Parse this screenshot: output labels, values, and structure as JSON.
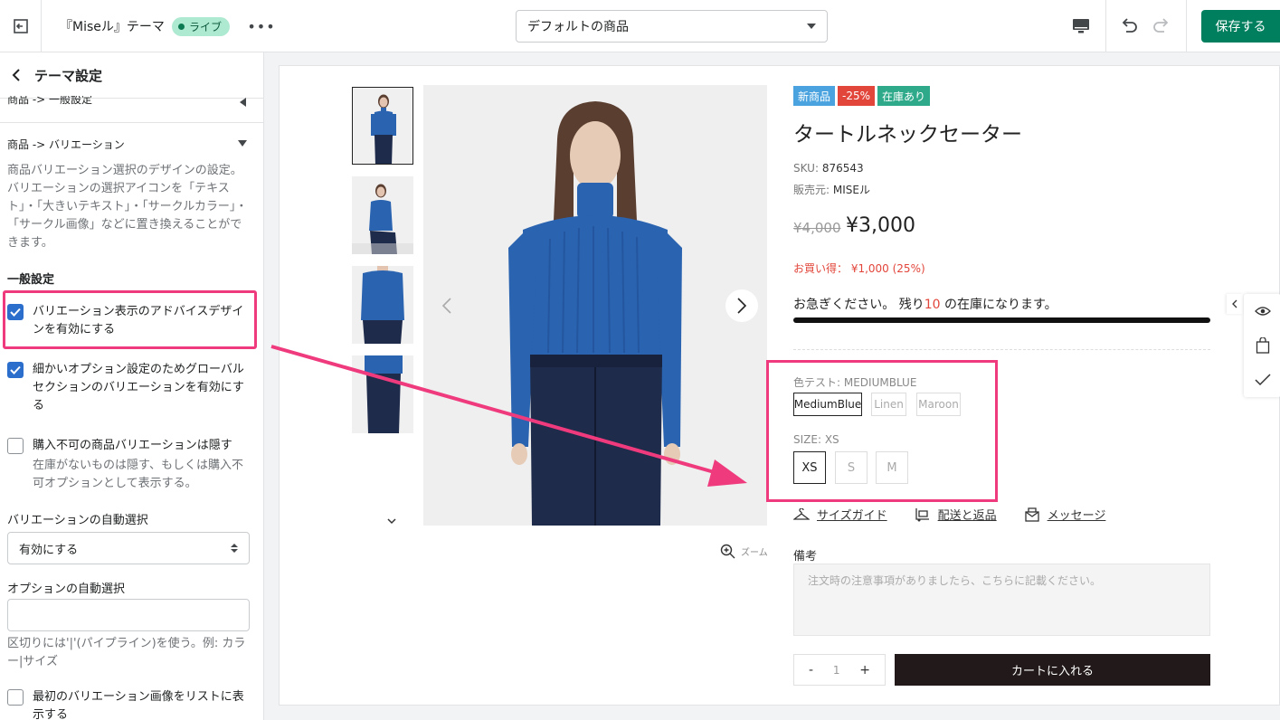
{
  "topbar": {
    "theme_name": "『Miseル』テーマ",
    "live_badge": "ライブ",
    "page_select": "デフォルトの商品",
    "save_label": "保存する"
  },
  "sidebar": {
    "title": "テーマ設定",
    "section_general": "商品 -> 一般設定",
    "section_variation": "商品 -> バリエーション",
    "description": "商品バリエーション選択のデザインの設定。バリエーションの選択アイコンを「テキスト」・「大きいテキスト」・「サークルカラー」・「サークル画像」などに置き換えることができます。",
    "general_heading": "一般設定",
    "checkbox1": "バリエーション表示のアドバイスデザインを有効にする",
    "checkbox2": "細かいオプション設定のためグローバルセクションのバリエーションを有効にする",
    "checkbox3": "購入不可の商品バリエーションは隠す",
    "checkbox3_help": "在庫がないものは隠す、もしくは購入不可オプションとして表示する。",
    "auto_select_label": "バリエーションの自動選択",
    "auto_select_value": "有効にする",
    "option_auto_label": "オプションの自動選択",
    "option_auto_value": "",
    "option_auto_help": "区切りには'|'(パイプライン)を使う。例: カラー|サイズ",
    "checkbox4": "最初のバリエーション画像をリストに表示する"
  },
  "product": {
    "badges": [
      "新商品",
      "-25%",
      "在庫あり"
    ],
    "badge_colors": [
      "#4aa3df",
      "#e2453a",
      "#2eaa8a"
    ],
    "title": "タートルネックセーター",
    "sku_label": "SKU:",
    "sku": "876543",
    "vendor_label": "販売元:",
    "vendor": "MISEル",
    "old_price": "¥4,000",
    "price": "¥3,000",
    "saving": "お買い得： ¥1,000 (25%)",
    "stock_pre": "お急ぎください。 残り",
    "stock_count": "10",
    "stock_post": "の在庫になります。",
    "color_label": "色テスト: MEDIUMBLUE",
    "colors": [
      "MediumBlue",
      "Linen",
      "Maroon"
    ],
    "size_label": "SIZE: XS",
    "sizes": [
      "XS",
      "S",
      "M"
    ],
    "link_size": "サイズガイド",
    "link_ship": "配送と返品",
    "link_msg": "メッセージ",
    "zoom": "ズーム",
    "note_label": "備考",
    "note_placeholder": "注文時の注意事項がありましたら、こちらに記載ください。",
    "qty_minus": "-",
    "qty_value": "1",
    "qty_plus": "+",
    "cart": "カートに入れる"
  },
  "colors": {
    "accent_green": "#007f5f",
    "highlight_pink": "#ef3b7d",
    "checkbox_blue": "#2c6ecb",
    "sweater_blue": "#2a63b0"
  }
}
